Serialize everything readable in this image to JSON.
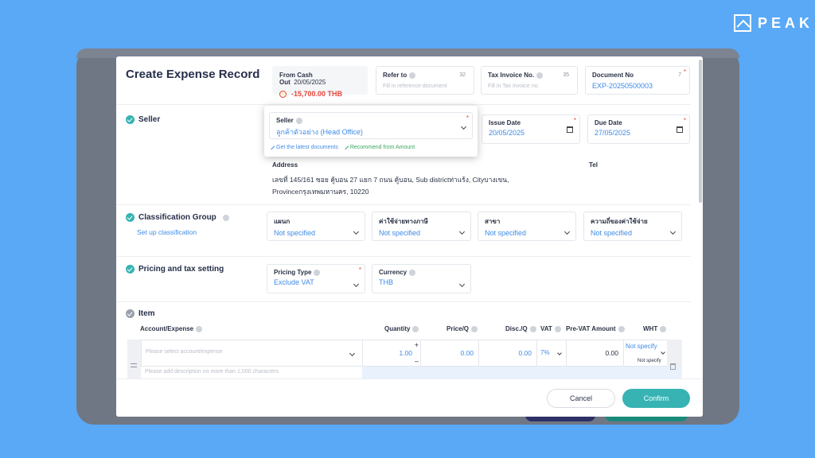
{
  "brand": {
    "name": "PEAK"
  },
  "modal": {
    "title": "Create Expense Record",
    "header": {
      "cash_out_label": "From Cash Out",
      "cash_out_date": "20/05/2025",
      "cash_out_amount": "-15,700.00 THB",
      "refer_to_label": "Refer to",
      "refer_to_count": "32",
      "refer_to_placeholder": "Fill in reference document",
      "tax_invoice_label": "Tax Invoice No.",
      "tax_invoice_count": "35",
      "tax_invoice_placeholder": "Fill in Tax invoice no.",
      "document_no_label": "Document No",
      "document_no_count": "7",
      "document_no_value": "EXP-20250500003"
    },
    "seller": {
      "section_title": "Seller",
      "field_label": "Seller",
      "field_value": "ลูกค้าตัวอย่าง (Head Office)",
      "link_latest": "Get the latest documents",
      "link_recommend": "Recommend from Amount",
      "issue_date_label": "Issue Date",
      "issue_date_value": "20/05/2025",
      "due_date_label": "Due Date",
      "due_date_value": "27/05/2025",
      "address_label": "Address",
      "address_line1": "เลขที่ 145/161 ซอย คู้บอน 27 แยก 7 ถนน คู้บอน, Sub districtท่าแร้ง, Cityบางเขน,",
      "address_line2": "Provinceกรุงเทพมหานคร, 10220",
      "tel_label": "Tel"
    },
    "classification": {
      "section_title": "Classification Group",
      "setup_link": "Set up classification",
      "fields": [
        {
          "label": "แผนก",
          "value": "Not specified"
        },
        {
          "label": "ค่าใช้จ่ายทางภาษี",
          "value": "Not specified"
        },
        {
          "label": "สาขา",
          "value": "Not specified"
        },
        {
          "label": "ความถี่ของค่าใช้จ่าย",
          "value": "Not specified"
        }
      ]
    },
    "pricing": {
      "section_title": "Pricing and tax setting",
      "pricing_type_label": "Pricing Type",
      "pricing_type_value": "Exclude VAT",
      "currency_label": "Currency",
      "currency_value": "THB"
    },
    "item": {
      "section_title": "Item",
      "columns": {
        "account": "Account/Expense",
        "quantity": "Quantity",
        "price": "Price/Q",
        "discount": "Disc./Q",
        "vat": "VAT",
        "pre_vat": "Pre-VAT Amount",
        "wht": "WHT"
      },
      "row": {
        "account_placeholder": "Please select account/expense",
        "quantity": "1.00",
        "price": "0.00",
        "discount": "0.00",
        "vat": "7%",
        "pre_vat": "0.00",
        "wht": "Not specify",
        "wht_overlay": "Not specify",
        "description_placeholder": "Please add description no more than 1,000 characters"
      }
    },
    "footer": {
      "cancel_label": "Cancel",
      "confirm_label": "Confirm"
    }
  },
  "colors": {
    "background": "#5aa9f6",
    "accent": "#38b3b4",
    "link": "#3e8be6",
    "negative": "#e4473b"
  }
}
